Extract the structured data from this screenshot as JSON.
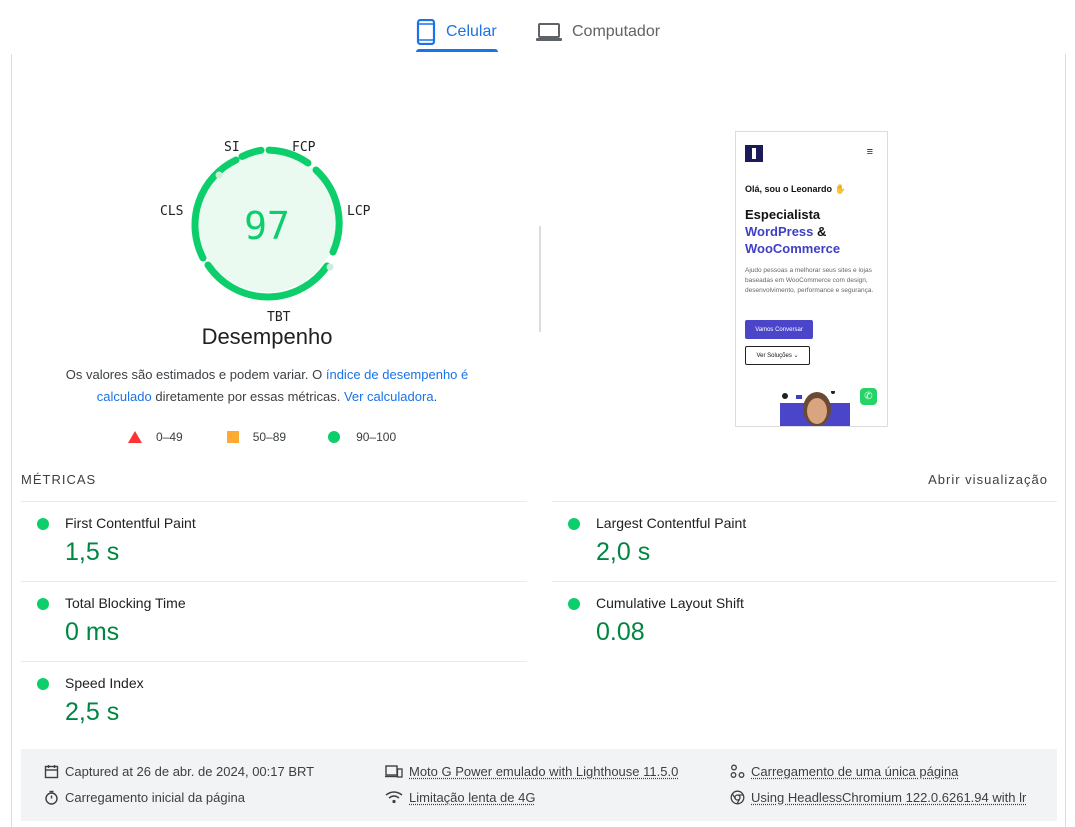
{
  "tabs": [
    {
      "label": "Celular",
      "icon": "smartphone-icon",
      "active": true
    },
    {
      "label": "Computador",
      "icon": "laptop-icon",
      "active": false
    }
  ],
  "gauge": {
    "score": "97",
    "title": "Desempenho",
    "color": "#0cce6b",
    "labels": {
      "si": "SI",
      "fcp": "FCP",
      "lcp": "LCP",
      "tbt": "TBT",
      "cls": "CLS"
    }
  },
  "description": {
    "text1": "Os valores são estimados e podem variar. O ",
    "link1": "índice de desempenho é calculado",
    "text2": " diretamente por essas métricas. ",
    "link2": "Ver calculadora",
    "text3": "."
  },
  "legend": [
    {
      "range": "0–49",
      "color": "#ff3333",
      "shape": "triangle"
    },
    {
      "range": "50–89",
      "color": "#ffaa33",
      "shape": "square"
    },
    {
      "range": "90–100",
      "color": "#0cce6b",
      "shape": "circle"
    }
  ],
  "screenshot": {
    "menu_icon": "hamburger-icon",
    "hello": "Olá, sou o Leonardo",
    "heading_line1": "Especialista",
    "heading_blue1": "WordPress",
    "heading_amp": " &",
    "heading_blue2": "WooCommerce",
    "paragraph": "Ajudo pessoas a melhorar seus sites e lojas baseadas em WooCommerce com design, desenvolvimento, performance e segurança.",
    "button_primary": "Vamos Conversar",
    "button_secondary": "Ver Soluções"
  },
  "metrics": {
    "heading": "MÉTRICAS",
    "toggle": "Abrir visualização",
    "items": [
      {
        "name": "First Contentful Paint",
        "value": "1,5 s"
      },
      {
        "name": "Largest Contentful Paint",
        "value": "2,0 s"
      },
      {
        "name": "Total Blocking Time",
        "value": "0 ms"
      },
      {
        "name": "Cumulative Layout Shift",
        "value": "0.08"
      },
      {
        "name": "Speed Index",
        "value": "2,5 s"
      }
    ]
  },
  "footer": {
    "captured": "Captured at 26 de abr. de 2024, 00:17 BRT",
    "initial_load": "Carregamento inicial da página",
    "device": "Moto G Power emulado with Lighthouse 11.5.0",
    "throttling": "Limitação lenta de 4G",
    "single_page": "Carregamento de uma única página",
    "browser": "Using HeadlessChromium 122.0.6261.94 with lr"
  }
}
